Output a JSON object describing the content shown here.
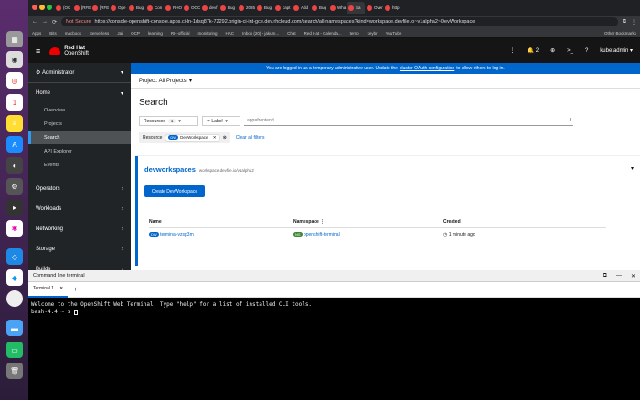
{
  "browser": {
    "tabs": [
      "(OC",
      "[RFE",
      "[RFE",
      "Ope",
      "Bug",
      "Con",
      "RHO",
      "OOC",
      "devf",
      "Bug",
      "2085",
      "Bug",
      "capt",
      "Add",
      "Bug",
      "Wha",
      "Sa",
      "Over",
      "http"
    ],
    "not_secure": "Not Secure",
    "url": "https://console-openshift-console.apps.ci-ln-1dsq87k-72292.origin-ci-int-gce.dev.rhcloud.com/search/all-namespaces?kind=workspace.devfile.io~v1alpha2~DevWorkspace",
    "bookmarks": [
      "Apps",
      "Bits",
      "macbook",
      "Serverless",
      "Jai",
      "OCP",
      "learning",
      "RH-official",
      "monitoring",
      "HAC",
      "Inbox (20) - jakum...",
      "Chat",
      "Red Hat - Calenda...",
      "temp",
      "keybr",
      "YouTube",
      "Other Bookmarks"
    ]
  },
  "masthead": {
    "brand_top": "Red Hat",
    "brand_bottom": "OpenShift",
    "notifications": "2",
    "user": "kube:admin"
  },
  "sidebar": {
    "perspective": "Administrator",
    "home": "Home",
    "home_items": [
      "Overview",
      "Projects",
      "Search",
      "API Explorer",
      "Events"
    ],
    "sections": [
      "Operators",
      "Workloads",
      "Networking",
      "Storage",
      "Builds"
    ]
  },
  "banner": {
    "pre": "You are logged in as a temporary administrative user. Update the",
    "link": "cluster OAuth configuration",
    "post": "to allow others to log in."
  },
  "project": "Project: All Projects",
  "page_title": "Search",
  "filters": {
    "resources": "Resources",
    "resources_count": "1",
    "label": "Label",
    "placeholder": "app=frontend",
    "slash": "/"
  },
  "chips": {
    "group": "Resource",
    "badge": "DW",
    "value": "DevWorkspace",
    "clear": "Clear all filters"
  },
  "panel": {
    "title": "devworkspaces",
    "api": "workspace.devfile.io/v1alpha2",
    "create": "Create DevWorkspace"
  },
  "table": {
    "headers": [
      "Name",
      "Namespace",
      "Created"
    ],
    "rows": [
      {
        "name_badge": "DW",
        "name": "terminal-vzsp3m",
        "ns_badge": "NS",
        "namespace": "openshift-terminal",
        "created": "1 minute ago"
      }
    ]
  },
  "terminal": {
    "title": "Command line terminal",
    "tab": "Terminal 1",
    "line1": "Welcome to the OpenShift Web Terminal. Type \"help\" for a list of installed CLI tools.",
    "line2": "bash-4.4 ~ $"
  }
}
